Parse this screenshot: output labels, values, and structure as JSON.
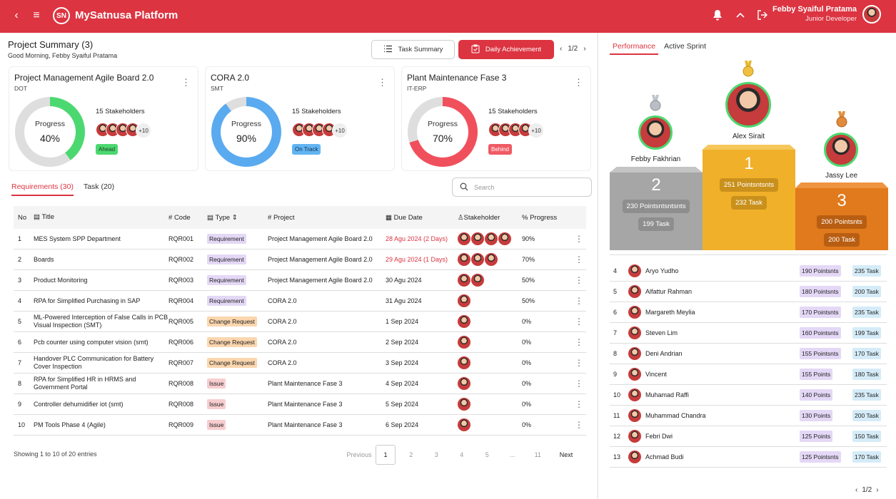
{
  "app": {
    "title": "MySatnusa Platform",
    "logo_text": "SN",
    "user_name": "Febby Syaiful Pratama",
    "user_role": "Junior Developer"
  },
  "summary": {
    "title": "Project Summary (3)",
    "greeting": "Good Morning, Febby Syaiful Pratama",
    "task_summary_label": "Task Summary",
    "daily_label": "Daily Achievement",
    "pager": "1/2"
  },
  "projects": [
    {
      "name": "Project Management Agile Board 2.0",
      "code": "DOT",
      "progress_label": "Progress",
      "progress": "40%",
      "progress_value": 40,
      "ring_color": "#4cd870",
      "stakeholders": "15 Stakeholders",
      "more": "+10",
      "status": "Ahead",
      "status_bg": "#4cd870",
      "status_fg": "#1b3d22"
    },
    {
      "name": "CORA 2.0",
      "code": "SMT",
      "progress_label": "Progress",
      "progress": "90%",
      "progress_value": 90,
      "ring_color": "#5aaaf0",
      "stakeholders": "15 Stakeholders",
      "more": "+10",
      "status": "On Track",
      "status_bg": "#62b4f2",
      "status_fg": "#11304a"
    },
    {
      "name": "Plant Maintenance Fase 3",
      "code": "IT-ERP",
      "progress_label": "Progress",
      "progress": "70%",
      "progress_value": 70,
      "ring_color": "#f0505c",
      "stakeholders": "15 Stakeholders",
      "more": "+10",
      "status": "Behind",
      "status_bg": "#f05a64",
      "status_fg": "#ffffff"
    }
  ],
  "tabs": {
    "requirements": "Requirements (30)",
    "task": "Task (20)",
    "search_placeholder": "Search"
  },
  "table": {
    "headers": {
      "no": "No",
      "title": "Title",
      "code": "Code",
      "type": "Type",
      "project": "Project",
      "due": "Due Date",
      "stakeholder": "Stakeholder",
      "progress": "Progress"
    },
    "rows": [
      {
        "no": "1",
        "title": "MES System SPP Department",
        "code": "RQR001",
        "type": "Requirement",
        "tag": "req",
        "project": "Project Management Agile Board 2.0",
        "due": "28 Agu 2024 (2 Days)",
        "overdue": true,
        "avatars": 4,
        "progress": "90%"
      },
      {
        "no": "2",
        "title": "Boards",
        "code": "RQR002",
        "type": "Requirement",
        "tag": "req",
        "project": "Project Management Agile Board 2.0",
        "due": "29 Agu 2024 (1 Days)",
        "overdue": true,
        "avatars": 3,
        "progress": "70%"
      },
      {
        "no": "3",
        "title": "Product Monitoring",
        "code": "RQR003",
        "type": "Requirement",
        "tag": "req",
        "project": "Project Management Agile Board 2.0",
        "due": "30 Agu 2024",
        "overdue": false,
        "avatars": 2,
        "progress": "50%"
      },
      {
        "no": "4",
        "title": "RPA for Simplified Purchasing in SAP",
        "code": "RQR004",
        "type": "Requirement",
        "tag": "req",
        "project": "CORA 2.0",
        "due": "31 Agu 2024",
        "overdue": false,
        "avatars": 1,
        "progress": "50%"
      },
      {
        "no": "5",
        "title": "ML-Powered Interception of False Calls in PCB Visual Inspection (SMT)",
        "code": "RQR005",
        "type": "Change Request",
        "tag": "chg",
        "project": "CORA 2.0",
        "due": "1 Sep 2024",
        "overdue": false,
        "avatars": 1,
        "progress": "0%"
      },
      {
        "no": "6",
        "title": "Pcb counter using computer vision (smt)",
        "code": "RQR006",
        "type": "Change Request",
        "tag": "chg",
        "project": "CORA 2.0",
        "due": "2 Sep 2024",
        "overdue": false,
        "avatars": 1,
        "progress": "0%"
      },
      {
        "no": "7",
        "title": "Handover PLC Communication for Battery Cover Inspection",
        "code": "RQR007",
        "type": "Change Request",
        "tag": "chg",
        "project": "CORA 2.0",
        "due": "3 Sep 2024",
        "overdue": false,
        "avatars": 1,
        "progress": "0%"
      },
      {
        "no": "8",
        "title": "RPA for Simplified HR in HRMS and Government Portal",
        "code": "RQR008",
        "type": "Issue",
        "tag": "iss",
        "project": "Plant Maintenance Fase 3",
        "due": "4 Sep 2024",
        "overdue": false,
        "avatars": 1,
        "progress": "0%"
      },
      {
        "no": "9",
        "title": "Controller dehumidifier iot (smt)",
        "code": "RQR008",
        "type": "Issue",
        "tag": "iss",
        "project": "Plant Maintenance Fase 3",
        "due": "5 Sep 2024",
        "overdue": false,
        "avatars": 1,
        "progress": "0%"
      },
      {
        "no": "10",
        "title": "PM Tools Phase 4 (Agile)",
        "code": "RQR009",
        "type": "Issue",
        "tag": "iss",
        "project": "Plant Maintenance Fase 3",
        "due": "6 Sep 2024",
        "overdue": false,
        "avatars": 1,
        "progress": "0%"
      }
    ]
  },
  "pagination": {
    "info": "Showing 1 to 10 of 20 entries",
    "previous": "Previous",
    "pages": [
      "1",
      "2",
      "3",
      "4",
      "5",
      "...",
      "11"
    ],
    "next": "Next"
  },
  "performance": {
    "tab_performance": "Performance",
    "tab_sprint": "Active Sprint",
    "podium": [
      {
        "rank": "2",
        "name": "Febby Fakhrian",
        "points": "230 Pointsntsntsnts",
        "tasks": "199 Task"
      },
      {
        "rank": "1",
        "name": "Alex Sirait",
        "points": "251 Pointsntsnts",
        "tasks": "232 Task"
      },
      {
        "rank": "3",
        "name": "Jassy Lee",
        "points": "200 Pointsnts",
        "tasks": "200 Task"
      }
    ],
    "list": [
      {
        "rank": "4",
        "name": "Aryo Yudho",
        "points": "190 Pointsnts",
        "tasks": "235 Task"
      },
      {
        "rank": "5",
        "name": "Alfattur Rahman",
        "points": "180 Pointsnts",
        "tasks": "200 Task"
      },
      {
        "rank": "6",
        "name": "Margareth Meylia",
        "points": "170 Pointsnts",
        "tasks": "235 Task"
      },
      {
        "rank": "7",
        "name": "Steven Lim",
        "points": "160 Pointsnts",
        "tasks": "199 Task"
      },
      {
        "rank": "8",
        "name": "Deni Andrian",
        "points": "155 Pointsnts",
        "tasks": "170 Task"
      },
      {
        "rank": "9",
        "name": "Vincent",
        "points": "155 Points",
        "tasks": "180 Task"
      },
      {
        "rank": "10",
        "name": "Muhamad Raffi",
        "points": "140 Points",
        "tasks": "235 Task"
      },
      {
        "rank": "11",
        "name": "Muhammad Chandra",
        "points": "130 Points",
        "tasks": "200 Task"
      },
      {
        "rank": "12",
        "name": "Febri Dwi",
        "points": "125 Points",
        "tasks": "150 Task"
      },
      {
        "rank": "13",
        "name": "Achmad Budi",
        "points": "125 Pointsnts",
        "tasks": "170 Task"
      }
    ],
    "pager": "1/2"
  }
}
